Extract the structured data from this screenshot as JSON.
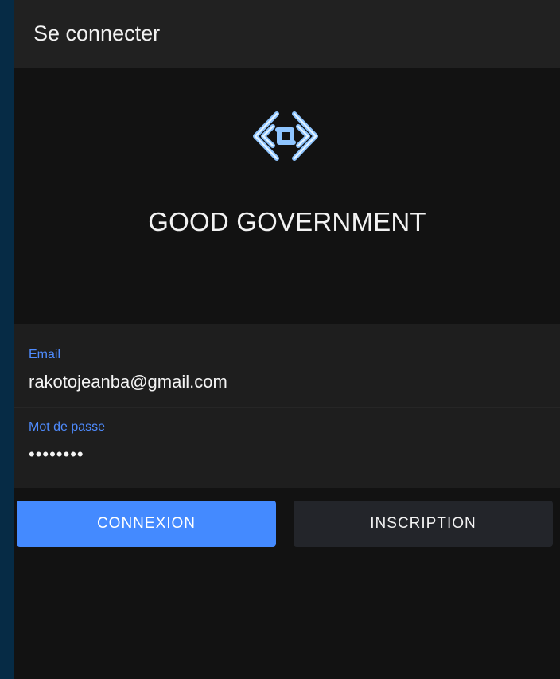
{
  "header": {
    "title": "Se connecter"
  },
  "hero": {
    "brand": "GOOD GOVERNMENT",
    "logo_icon": "link-icon"
  },
  "form": {
    "email": {
      "label": "Email",
      "value": "rakotojeanba@gmail.com"
    },
    "password": {
      "label": "Mot de passe",
      "value": "••••••••"
    }
  },
  "buttons": {
    "login": "CONNEXION",
    "register": "INSCRIPTION"
  },
  "colors": {
    "accent": "#448aff",
    "background": "#121212",
    "surface": "#1e1e1e",
    "header": "#212121"
  }
}
